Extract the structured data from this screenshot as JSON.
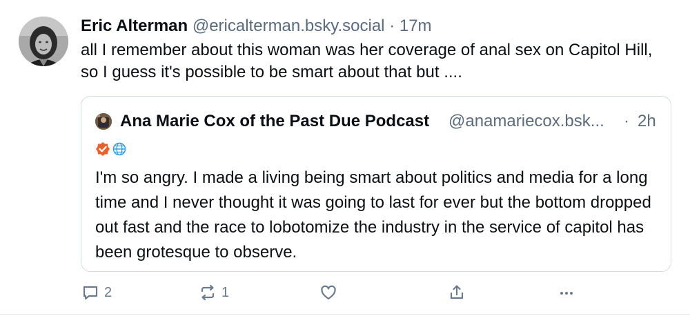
{
  "post": {
    "author_name": "Eric Alterman",
    "handle": "@ericalterman.bsky.social",
    "separator": "·",
    "time": "17m",
    "text": "all I remember about this woman was her coverage of anal sex on Capitol Hill, so I guess it's possible to be smart about that but ...."
  },
  "quote": {
    "author_name": "Ana Marie Cox of the Past Due Podcast",
    "handle": "@anamariecox.bsk...",
    "separator": "·",
    "time": "2h",
    "badges": [
      "verified-check-icon",
      "globe-icon"
    ],
    "text": "I'm so angry. I made a living being smart about politics and media for a long time and I never thought it was going to last for ever but the bottom dropped out fast and the race to lobotomize the industry in the service of capitol has been grotesque to observe."
  },
  "actions": {
    "reply_count": "2",
    "repost_count": "1",
    "icons": [
      "reply-icon",
      "repost-icon",
      "like-icon",
      "share-icon",
      "more-icon"
    ]
  },
  "colors": {
    "text": "#0b0f14",
    "muted": "#5b6b7c",
    "action": "#6b7a8c",
    "border": "#d4dbe2",
    "badge_orange": "#e8602c",
    "badge_blue": "#3c9fe0"
  }
}
